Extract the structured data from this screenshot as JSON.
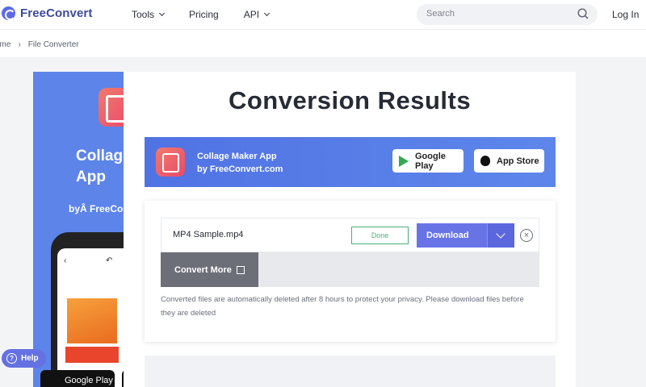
{
  "header": {
    "logo_text": "FreeConvert",
    "nav": [
      {
        "label": "Tools",
        "dropdown": true
      },
      {
        "label": "Pricing",
        "dropdown": false
      },
      {
        "label": "API",
        "dropdown": true
      }
    ],
    "search_placeholder": "Search",
    "login_label": "Log In"
  },
  "breadcrumb": [
    "ome",
    "File Converter"
  ],
  "left_ad": {
    "title": "Collage Maker App",
    "by": "byÂ FreeConvert",
    "store_label": "Google Play"
  },
  "help_label": "Help",
  "main": {
    "title": "Conversion Results",
    "banner": {
      "app_name": "Collage Maker App",
      "by": "by FreeConvert.com",
      "google_play": "Google Play",
      "app_store": "App Store"
    },
    "file": {
      "name": "MP4 Sample.mp4",
      "status": "Done",
      "download_label": "Download"
    },
    "convert_more_label": "Convert More",
    "note": "Converted files are automatically deleted after 8 hours to protect your privacy. Please download files before they are deleted"
  },
  "colors": {
    "accent": "#6874e6",
    "banner": "#5073e4",
    "done": "#4caf7d"
  }
}
